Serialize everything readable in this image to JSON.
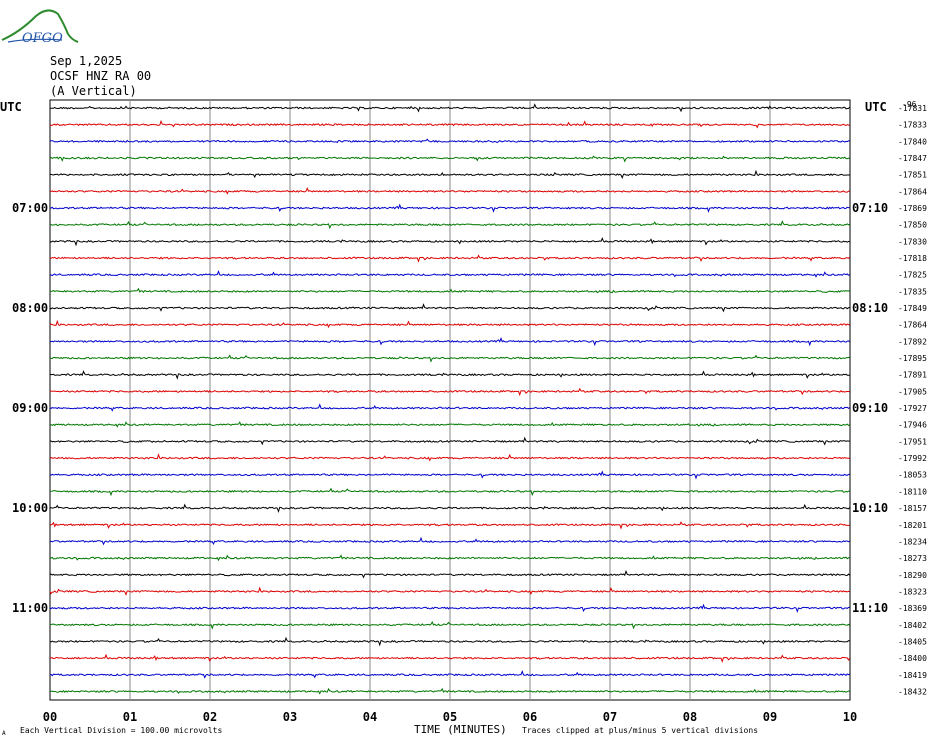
{
  "header": {
    "logo_text": "OFGO",
    "date": "Sep 1,2025",
    "station": "OCSF HNZ RA 00",
    "component": "(A Vertical)"
  },
  "footer": {
    "scale_note": "Each Vertical Division =  100.00 microvolts",
    "clip_note": "Traces clipped at plus/minus 5 vertical divisions",
    "corner_mark": "A"
  },
  "chart_data": {
    "type": "line",
    "title": "OCSF HNZ RA 00 (A Vertical)",
    "xlabel": "TIME (MINUTES)",
    "ylabel_left": "UTC",
    "ylabel_right": "UTC",
    "xlim": [
      0,
      10
    ],
    "x_ticks": [
      "00",
      "01",
      "02",
      "03",
      "04",
      "05",
      "06",
      "07",
      "08",
      "09",
      "10"
    ],
    "left_time_labels": [
      {
        "row": 6,
        "label": "07:00"
      },
      {
        "row": 12,
        "label": "08:00"
      },
      {
        "row": 18,
        "label": "09:00"
      },
      {
        "row": 24,
        "label": "10:00"
      },
      {
        "row": 30,
        "label": "11:00"
      }
    ],
    "right_time_labels": [
      {
        "row": 6,
        "label": "07:10"
      },
      {
        "row": 12,
        "label": "08:10"
      },
      {
        "row": 18,
        "label": "09:10"
      },
      {
        "row": 24,
        "label": "10:10"
      },
      {
        "row": 30,
        "label": "11:10"
      }
    ],
    "right_top_mark": "-96",
    "trace_colors": [
      "#000000",
      "#dd0000",
      "#0000cc",
      "#007700"
    ],
    "trace_offsets": [
      "-17831",
      "-17833",
      "-17840",
      "-17847",
      "-17851",
      "-17864",
      "-17869",
      "-17850",
      "-17830",
      "-17818",
      "-17825",
      "-17835",
      "-17849",
      "-17864",
      "-17892",
      "-17895",
      "-17891",
      "-17905",
      "-17927",
      "-17946",
      "-17951",
      "-17992",
      "-18053",
      "-18110",
      "-18157",
      "-18201",
      "-18234",
      "-18273",
      "-18290",
      "-18323",
      "-18369",
      "-18402",
      "-18405",
      "-18400",
      "-18419",
      "-18432"
    ],
    "grid": true
  }
}
